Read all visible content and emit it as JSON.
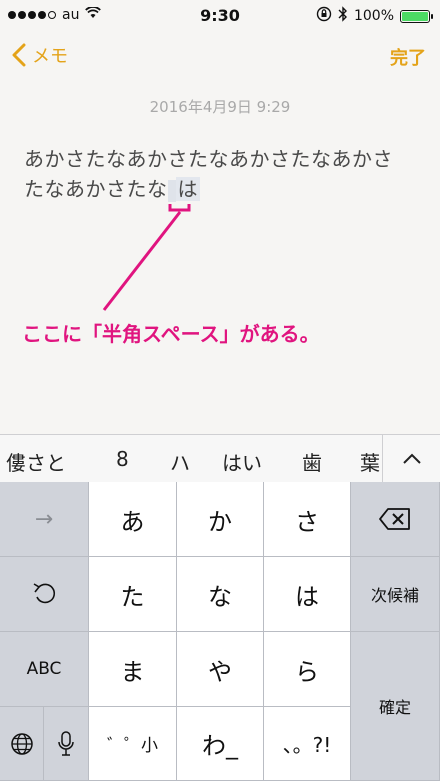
{
  "status": {
    "carrier": "au",
    "time": "9:30",
    "battery": "100%",
    "battery_level": 1.0
  },
  "nav": {
    "back_label": "メモ",
    "done_label": "完了"
  },
  "note": {
    "date": "2016年4月9日 9:29",
    "line1": "あかさたなあかさたなあかさたなあかさ",
    "line2": "たなあかさたな",
    "last_char": "は"
  },
  "annotation": {
    "text": "ここに「半角スペース」がある。",
    "color": "#e0147f"
  },
  "candidates": [
    "僂さと",
    "8",
    "ハ",
    "はい",
    "歯",
    "葉"
  ],
  "keyboard": {
    "row1": [
      "→",
      "あ",
      "か",
      "さ",
      "⌫"
    ],
    "row2": [
      "↺",
      "た",
      "な",
      "は",
      "次候補"
    ],
    "row3": [
      "ABC",
      "ま",
      "や",
      "ら",
      "確定"
    ],
    "row4": [
      "゛゜小",
      "わ_",
      "、。?!"
    ],
    "globe": "globe-icon",
    "mic": "mic-icon"
  },
  "colors": {
    "accent": "#e4a319",
    "annotation": "#e0147f"
  }
}
